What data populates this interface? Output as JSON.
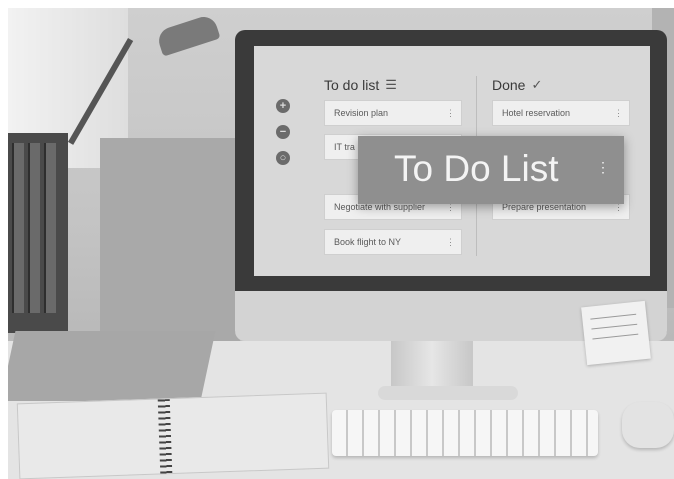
{
  "screen": {
    "side_icons": [
      "add-icon",
      "remove-icon",
      "circle-icon"
    ],
    "todo": {
      "title": "To do list",
      "title_icon": "list-icon",
      "cards": [
        "Revision plan",
        "IT tra",
        "Negotiate with supplier",
        "Book flight to NY"
      ]
    },
    "done": {
      "title": "Done",
      "title_icon": "checkmark-icon",
      "cards": [
        "Hotel reservation",
        "Prepare presentation"
      ]
    },
    "overlay": {
      "title": "To Do List",
      "menu_icon": "kebab-menu-icon"
    }
  }
}
